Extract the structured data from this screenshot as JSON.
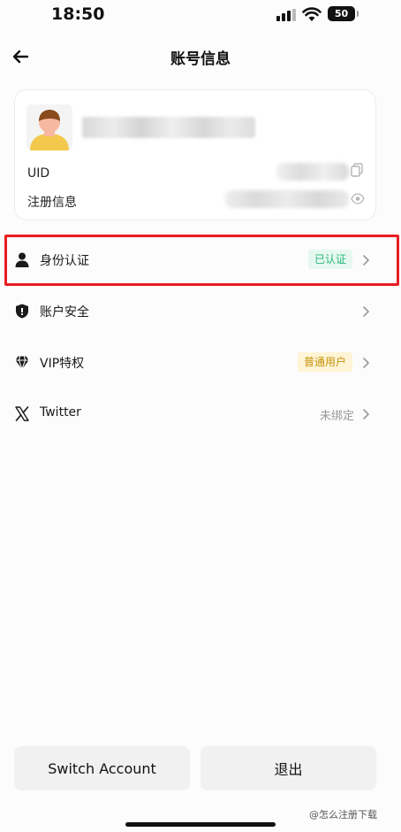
{
  "status_bar": {
    "time": "18:50",
    "battery": "50",
    "icons": [
      "signal-icon",
      "wifi-icon",
      "battery-icon"
    ]
  },
  "header": {
    "title": "账号信息",
    "back_icon": "arrow-left-icon"
  },
  "profile": {
    "uid_label": "UID",
    "registration_label": "注册信息",
    "icons": [
      "avatar",
      "copy-icon",
      "eye-icon"
    ]
  },
  "menu": [
    {
      "label": "身份认证",
      "icon": "person-icon",
      "badge": "已认证"
    },
    {
      "label": "账户安全",
      "icon": "shield-icon"
    },
    {
      "label": "VIP特权",
      "icon": "diamond-icon",
      "badge": "普通用户"
    },
    {
      "label": "Twitter",
      "icon": "x-logo-icon",
      "status": "未绑定"
    }
  ],
  "buttons": {
    "switch_account": "Switch Account",
    "logout": "退出"
  },
  "watermark": "@怎么注册下载",
  "colors": {
    "highlight": "#e81d22",
    "verified": "#2cb77b",
    "vip": "#c7920a"
  }
}
